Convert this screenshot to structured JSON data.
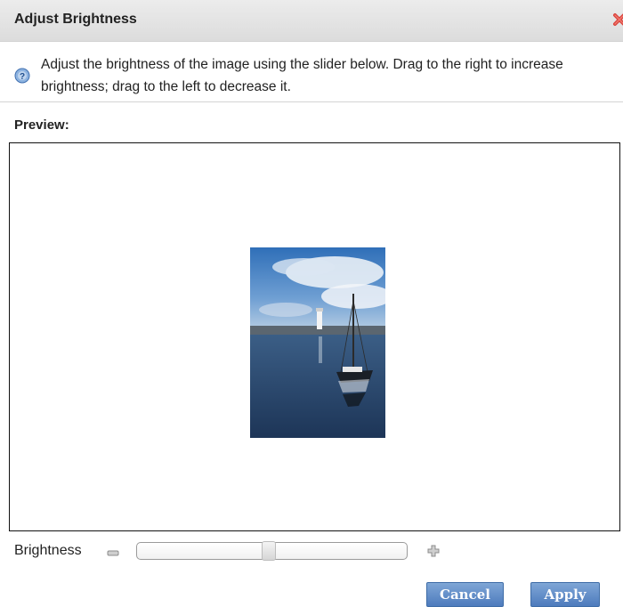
{
  "dialog": {
    "title": "Adjust Brightness",
    "close_icon": "close-x-icon",
    "info_icon": "help-icon",
    "instructions": "Adjust the brightness of the image using the slider below. Drag to the right to increase brightness; drag to the left to decrease it."
  },
  "preview": {
    "label": "Preview:",
    "image_icon": "boat-harbor-photo"
  },
  "brightness": {
    "label": "Brightness",
    "decrease_icon": "minus-icon",
    "increase_icon": "plus-icon",
    "value_fraction": 0.49
  },
  "buttons": {
    "cancel": "Cancel",
    "apply": "Apply"
  },
  "colors": {
    "button_bg": "#5a86c4",
    "titlebar_bg": "#e2e2e2",
    "close_red": "#d9403a"
  }
}
